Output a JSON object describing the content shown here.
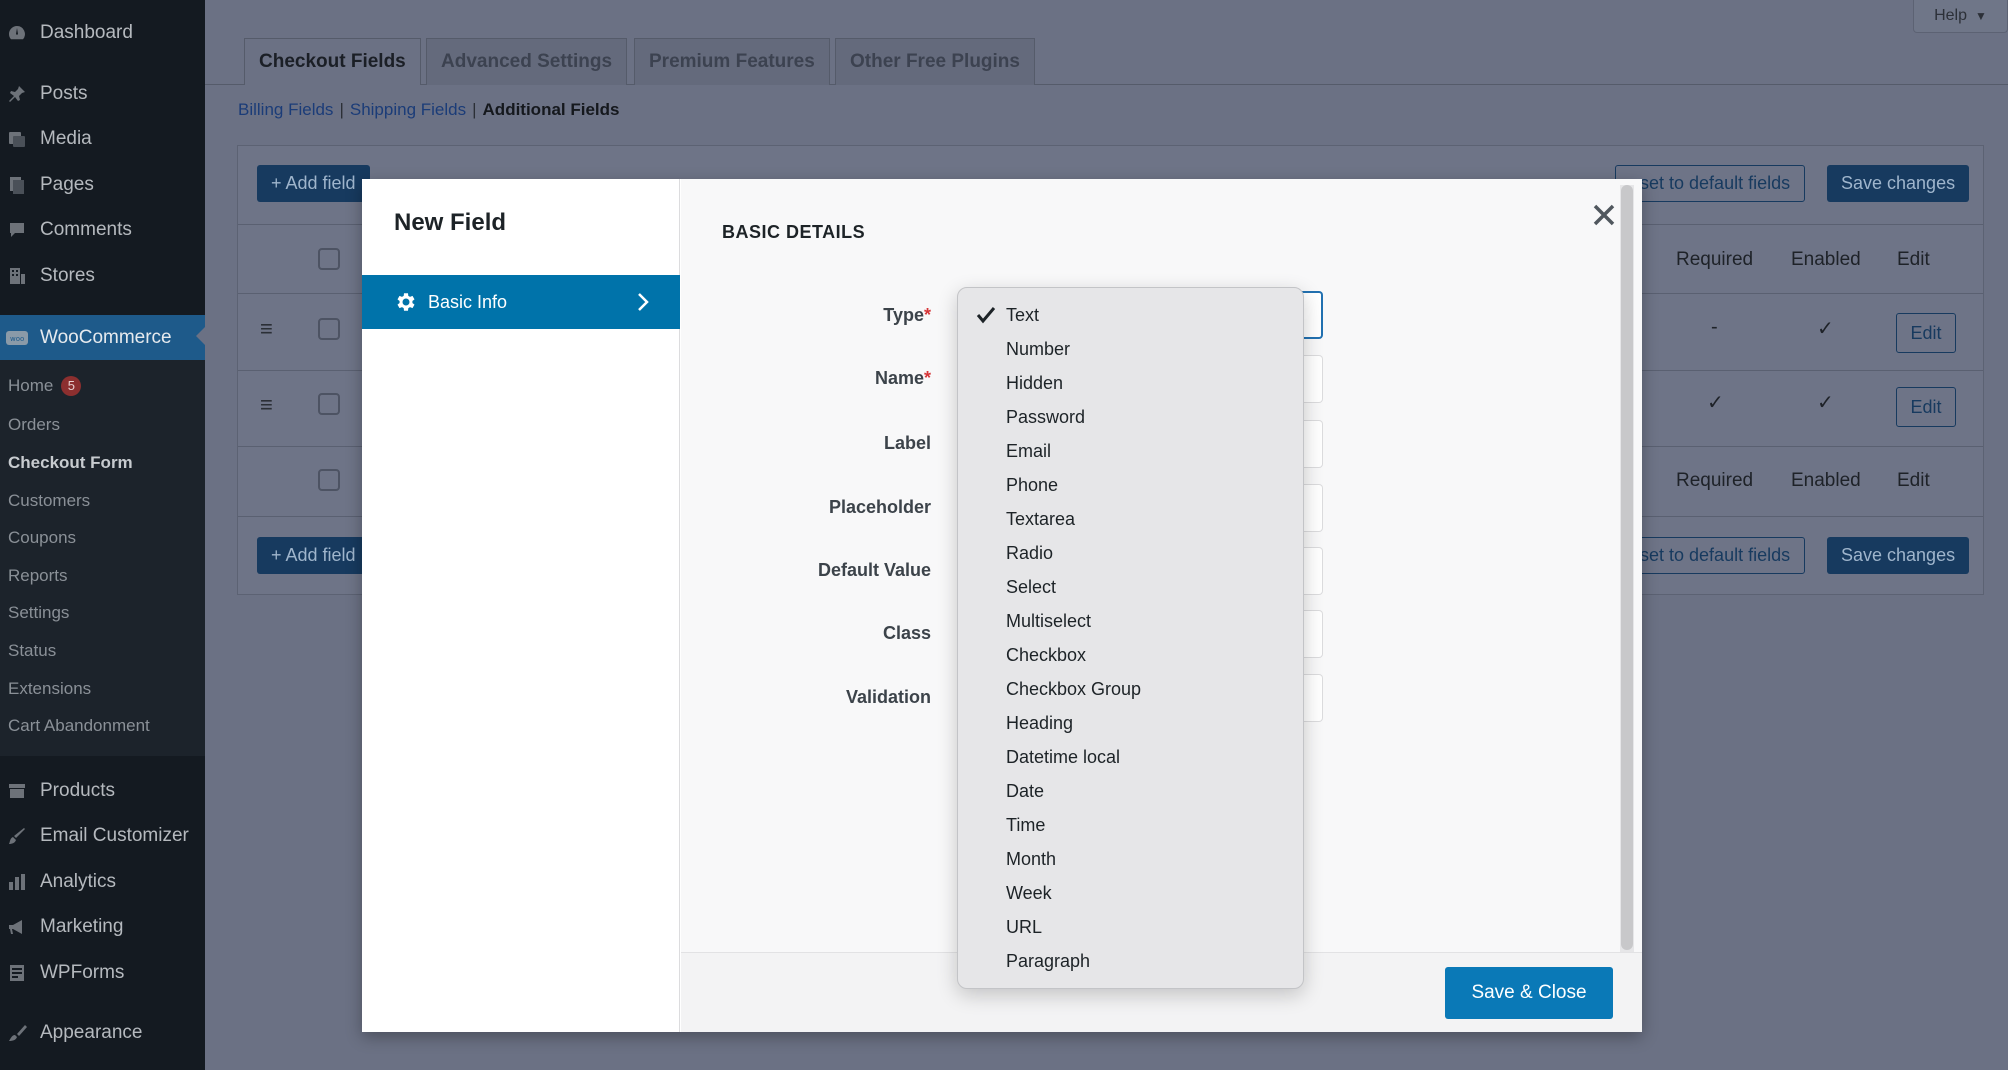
{
  "sidebar": {
    "items": [
      {
        "label": "Dashboard",
        "icon": "dashboard-icon"
      },
      {
        "label": "Posts",
        "icon": "pin-icon"
      },
      {
        "label": "Media",
        "icon": "media-icon"
      },
      {
        "label": "Pages",
        "icon": "pages-icon"
      },
      {
        "label": "Comments",
        "icon": "comment-icon"
      },
      {
        "label": "Stores",
        "icon": "building-icon"
      },
      {
        "label": "WooCommerce",
        "icon": "woo-icon"
      },
      {
        "label": "Products",
        "icon": "archive-icon"
      },
      {
        "label": "Email Customizer",
        "icon": "brush-icon"
      },
      {
        "label": "Analytics",
        "icon": "chart-icon"
      },
      {
        "label": "Marketing",
        "icon": "megaphone-icon"
      },
      {
        "label": "WPForms",
        "icon": "forms-icon"
      },
      {
        "label": "Appearance",
        "icon": "paintbrush-icon"
      }
    ],
    "submenu": [
      {
        "label": "Home",
        "badge": "5"
      },
      {
        "label": "Orders"
      },
      {
        "label": "Checkout Form"
      },
      {
        "label": "Customers"
      },
      {
        "label": "Coupons"
      },
      {
        "label": "Reports"
      },
      {
        "label": "Settings"
      },
      {
        "label": "Status"
      },
      {
        "label": "Extensions"
      },
      {
        "label": "Cart Abandonment"
      }
    ]
  },
  "help": {
    "label": "Help"
  },
  "tabs": [
    "Checkout Fields",
    "Advanced Settings",
    "Premium Features",
    "Other Free Plugins"
  ],
  "subnav": {
    "billing": "Billing Fields",
    "shipping": "Shipping Fields",
    "sep": "|",
    "additional": "Additional Fields"
  },
  "toolbar": {
    "add_field": "+ Add field",
    "reset": "eset to default fields",
    "save": "Save changes"
  },
  "table": {
    "headers": {
      "required": "Required",
      "enabled": "Enabled",
      "edit": "Edit"
    },
    "rows": [
      {
        "required": "-",
        "enabled": "✓",
        "edit": "Edit"
      },
      {
        "required": "✓",
        "enabled": "✓",
        "edit": "Edit"
      }
    ]
  },
  "modal": {
    "title": "New Field",
    "menu_item": "Basic Info",
    "section": "BASIC DETAILS",
    "fields": [
      {
        "label": "Type",
        "required": true
      },
      {
        "label": "Name",
        "required": true
      },
      {
        "label": "Label",
        "required": false
      },
      {
        "label": "Placeholder",
        "required": false
      },
      {
        "label": "Default Value",
        "required": false
      },
      {
        "label": "Class",
        "required": false
      },
      {
        "label": "Validation",
        "required": false
      }
    ],
    "required_mark": "*",
    "save_close": "Save & Close"
  },
  "dropdown": {
    "selected": "Text",
    "options": [
      "Text",
      "Number",
      "Hidden",
      "Password",
      "Email",
      "Phone",
      "Textarea",
      "Radio",
      "Select",
      "Multiselect",
      "Checkbox",
      "Checkbox Group",
      "Heading",
      "Datetime local",
      "Date",
      "Time",
      "Month",
      "Week",
      "URL",
      "Paragraph"
    ]
  },
  "colors": {
    "accent": "#0073aa",
    "sidebar_bg": "#141a21",
    "overlay": "#6b7184",
    "required": "#d63638"
  }
}
